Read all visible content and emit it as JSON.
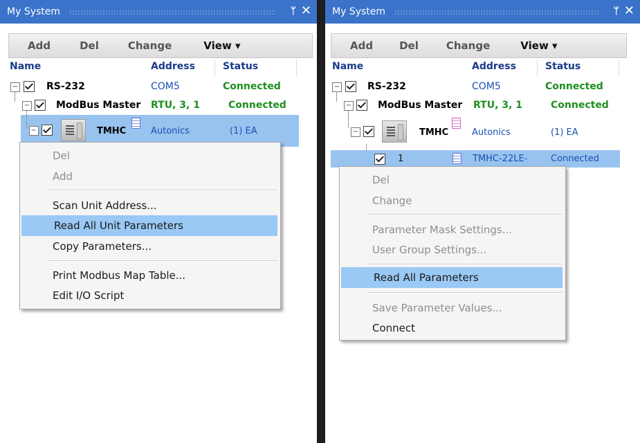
{
  "left": {
    "title": "My System",
    "toolbar": {
      "add": "Add",
      "del": "Del",
      "change": "Change",
      "view": "View ▾"
    },
    "columns": {
      "name": "Name",
      "address": "Address",
      "status": "Status"
    },
    "rows": [
      {
        "name": "RS-232",
        "address": "COM5",
        "status": "Connected"
      },
      {
        "name": "ModBus Master",
        "address": "RTU, 3, 1",
        "status": "Connected"
      },
      {
        "name": "TMHC",
        "address": "Autonics",
        "status": "(1) EA"
      }
    ],
    "menu": [
      "Del",
      "Add",
      "Scan Unit Address...",
      "Read All Unit Parameters",
      "Copy Parameters...",
      "Print Modbus Map Table...",
      "Edit I/O Script"
    ]
  },
  "right": {
    "title": "My System",
    "toolbar": {
      "add": "Add",
      "del": "Del",
      "change": "Change",
      "view": "View ▾"
    },
    "columns": {
      "name": "Name",
      "address": "Address",
      "status": "Status"
    },
    "rows": [
      {
        "name": "RS-232",
        "address": "COM5",
        "status": "Connected"
      },
      {
        "name": "ModBus Master",
        "address": "RTU, 3, 1",
        "status": "Connected"
      },
      {
        "name": "TMHC",
        "address": "Autonics",
        "status": "(1) EA"
      },
      {
        "name": "1",
        "address": "TMHC-22LE-",
        "status": "Connected"
      }
    ],
    "menu": [
      "Del",
      "Change",
      "Parameter Mask Settings...",
      "User Group Settings...",
      "Read All Parameters",
      "Save Parameter Values...",
      "Connect"
    ]
  },
  "icons": {
    "pin": "pin-icon",
    "close": "close-icon",
    "expand": "collapse-box-icon",
    "check": "checkbox-icon",
    "device": "device-icon",
    "doc": "document-icon"
  },
  "colors": {
    "titlebar": "#3a73c9",
    "selection": "#99c3ef",
    "connected": "#1f8f1f",
    "header": "#1a3a8a"
  }
}
